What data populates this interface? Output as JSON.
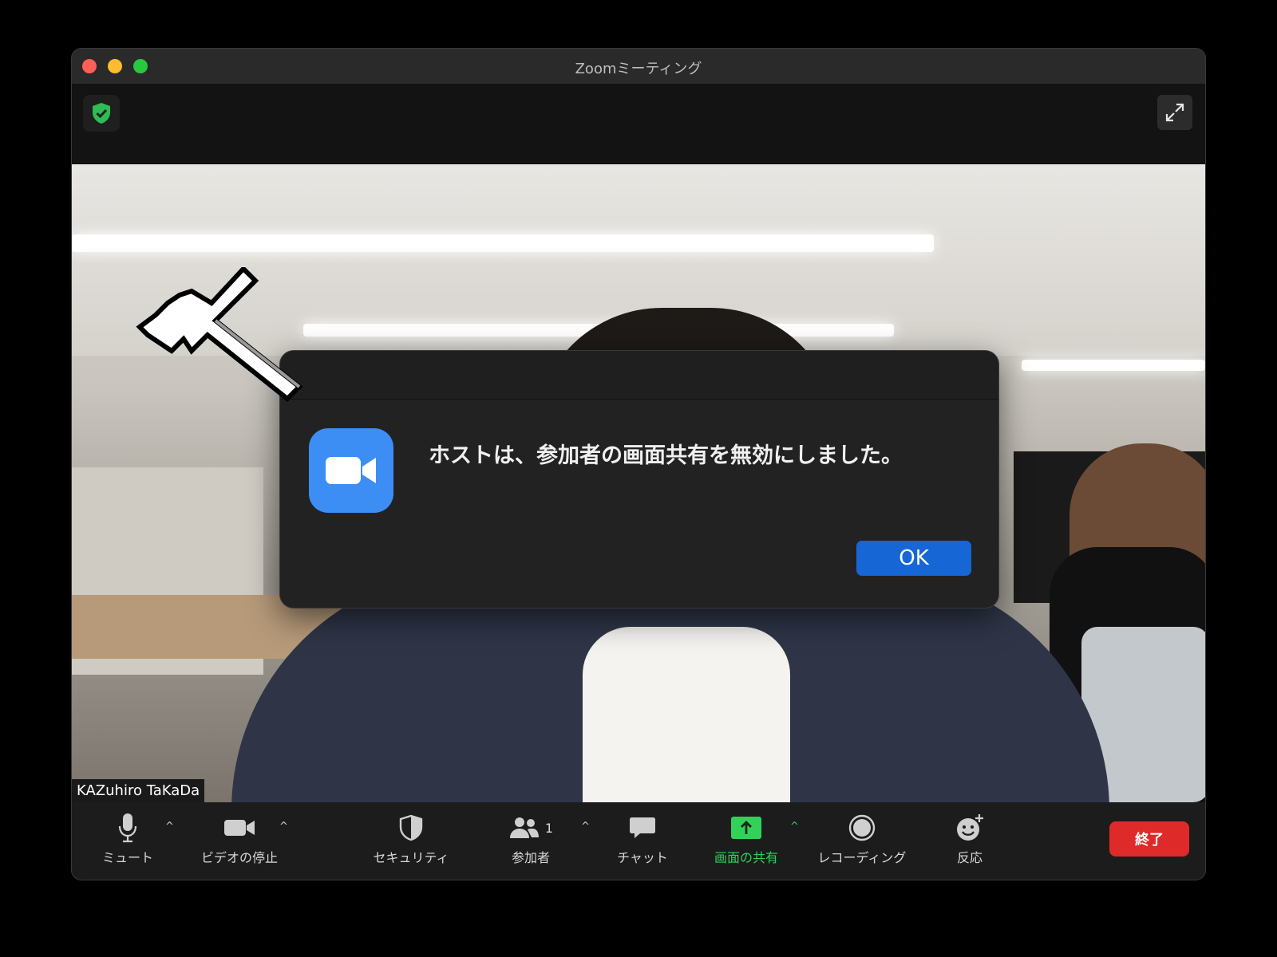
{
  "window": {
    "title": "Zoomミーティング"
  },
  "video": {
    "participant_name": "KAZuhiro TaKaDa"
  },
  "toolbar": {
    "mute_label": "ミュート",
    "video_label": "ビデオの停止",
    "security_label": "セキュリティ",
    "participants_label": "参加者",
    "participants_count": "1",
    "chat_label": "チャット",
    "share_label": "画面の共有",
    "record_label": "レコーディング",
    "reaction_label": "反応",
    "end_label": "終了"
  },
  "dialog": {
    "message": "ホストは、参加者の画面共有を無効にしました。",
    "ok_label": "OK"
  },
  "colors": {
    "share_green": "#34d15a",
    "end_red": "#df2a2a",
    "ok_blue": "#1766d6",
    "zoom_blue": "#3c8ef5"
  }
}
